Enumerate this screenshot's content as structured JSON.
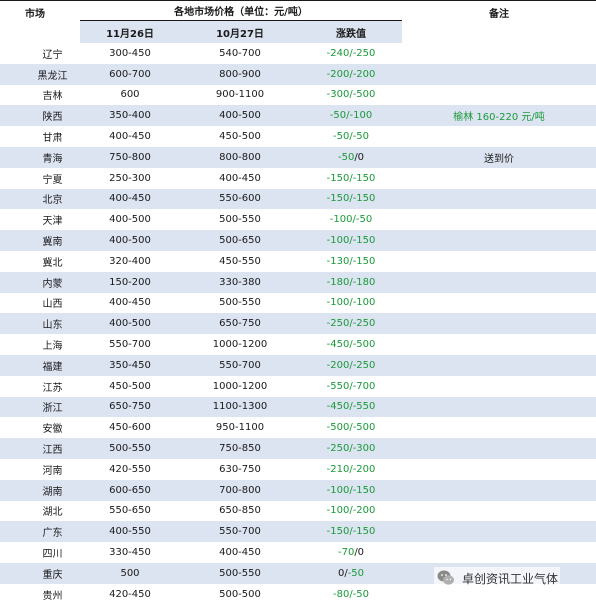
{
  "header": {
    "market": "市场",
    "group": "各地市场价格（单位：元/吨）",
    "date_new": "11月26日",
    "date_old": "10月27日",
    "change": "涨跌值",
    "remark": "备注"
  },
  "rows": [
    {
      "market": "辽宁",
      "nov26": "300-450",
      "oct27": "540-700",
      "chg": [
        {
          "t": "-240/-250",
          "g": true
        }
      ],
      "note": ""
    },
    {
      "market": "黑龙江",
      "nov26": "600-700",
      "oct27": "800-900",
      "chg": [
        {
          "t": "-200/-200",
          "g": true
        }
      ],
      "note": ""
    },
    {
      "market": "吉林",
      "nov26": "600",
      "oct27": "900-1100",
      "chg": [
        {
          "t": "-300/-500",
          "g": true
        }
      ],
      "note": ""
    },
    {
      "market": "陕西",
      "nov26": "350-400",
      "oct27": "400-500",
      "chg": [
        {
          "t": "-50/-100",
          "g": true
        }
      ],
      "note": "榆林 160-220 元/吨",
      "note_green": true
    },
    {
      "market": "甘肃",
      "nov26": "400-450",
      "oct27": "450-500",
      "chg": [
        {
          "t": "-50/-50",
          "g": true
        }
      ],
      "note": ""
    },
    {
      "market": "青海",
      "nov26": "750-800",
      "oct27": "800-800",
      "chg": [
        {
          "t": "-50",
          "g": true
        },
        {
          "t": "/0",
          "g": false
        }
      ],
      "note": "送到价",
      "note_green": false
    },
    {
      "market": "宁夏",
      "nov26": "250-300",
      "oct27": "400-450",
      "chg": [
        {
          "t": "-150/-150",
          "g": true
        }
      ],
      "note": ""
    },
    {
      "market": "北京",
      "nov26": "400-450",
      "oct27": "550-600",
      "chg": [
        {
          "t": "-150/-150",
          "g": true
        }
      ],
      "note": ""
    },
    {
      "market": "天津",
      "nov26": "400-500",
      "oct27": "500-550",
      "chg": [
        {
          "t": "-100/-50",
          "g": true
        }
      ],
      "note": ""
    },
    {
      "market": "冀南",
      "nov26": "400-500",
      "oct27": "500-650",
      "chg": [
        {
          "t": "-100/-150",
          "g": true
        }
      ],
      "note": ""
    },
    {
      "market": "冀北",
      "nov26": "320-400",
      "oct27": "450-550",
      "chg": [
        {
          "t": "-130/-150",
          "g": true
        }
      ],
      "note": ""
    },
    {
      "market": "内蒙",
      "nov26": "150-200",
      "oct27": "330-380",
      "chg": [
        {
          "t": "-180/-180",
          "g": true
        }
      ],
      "note": ""
    },
    {
      "market": "山西",
      "nov26": "400-450",
      "oct27": "500-550",
      "chg": [
        {
          "t": "-100/-100",
          "g": true
        }
      ],
      "note": ""
    },
    {
      "market": "山东",
      "nov26": "400-500",
      "oct27": "650-750",
      "chg": [
        {
          "t": "-250/-250",
          "g": true
        }
      ],
      "note": ""
    },
    {
      "market": "上海",
      "nov26": "550-700",
      "oct27": "1000-1200",
      "chg": [
        {
          "t": "-450/-500",
          "g": true
        }
      ],
      "note": ""
    },
    {
      "market": "福建",
      "nov26": "350-450",
      "oct27": "550-700",
      "chg": [
        {
          "t": "-200/-250",
          "g": true
        }
      ],
      "note": ""
    },
    {
      "market": "江苏",
      "nov26": "450-500",
      "oct27": "1000-1200",
      "chg": [
        {
          "t": "-550/-700",
          "g": true
        }
      ],
      "note": ""
    },
    {
      "market": "浙江",
      "nov26": "650-750",
      "oct27": "1100-1300",
      "chg": [
        {
          "t": "-450/-550",
          "g": true
        }
      ],
      "note": ""
    },
    {
      "market": "安徽",
      "nov26": "450-600",
      "oct27": "950-1100",
      "chg": [
        {
          "t": "-500/-500",
          "g": true
        }
      ],
      "note": ""
    },
    {
      "market": "江西",
      "nov26": "500-550",
      "oct27": "750-850",
      "chg": [
        {
          "t": "-250/-300",
          "g": true
        }
      ],
      "note": ""
    },
    {
      "market": "河南",
      "nov26": "420-550",
      "oct27": "630-750",
      "chg": [
        {
          "t": "-210/-200",
          "g": true
        }
      ],
      "note": ""
    },
    {
      "market": "湖南",
      "nov26": "600-650",
      "oct27": "700-800",
      "chg": [
        {
          "t": "-100/-150",
          "g": true
        }
      ],
      "note": ""
    },
    {
      "market": "湖北",
      "nov26": "550-650",
      "oct27": "650-850",
      "chg": [
        {
          "t": "-100/-200",
          "g": true
        }
      ],
      "note": ""
    },
    {
      "market": "广东",
      "nov26": "400-550",
      "oct27": "550-700",
      "chg": [
        {
          "t": "-150/-150",
          "g": true
        }
      ],
      "note": ""
    },
    {
      "market": "四川",
      "nov26": "330-450",
      "oct27": "400-450",
      "chg": [
        {
          "t": "-70",
          "g": true
        },
        {
          "t": "/0",
          "g": false
        }
      ],
      "note": ""
    },
    {
      "market": "重庆",
      "nov26": "500",
      "oct27": "500-550",
      "chg": [
        {
          "t": "0/",
          "g": false
        },
        {
          "t": "-50",
          "g": true
        }
      ],
      "note": ""
    },
    {
      "market": "贵州",
      "nov26": "420-450",
      "oct27": "500-500",
      "chg": [
        {
          "t": "-80/-50",
          "g": true
        }
      ],
      "note": ""
    }
  ],
  "watermark": {
    "text": "卓创资讯工业气体",
    "icon": "wechat-icon"
  },
  "colors": {
    "stripe": "#dce3f1",
    "down": "#1a9a3a",
    "text": "#1a1a1a"
  }
}
